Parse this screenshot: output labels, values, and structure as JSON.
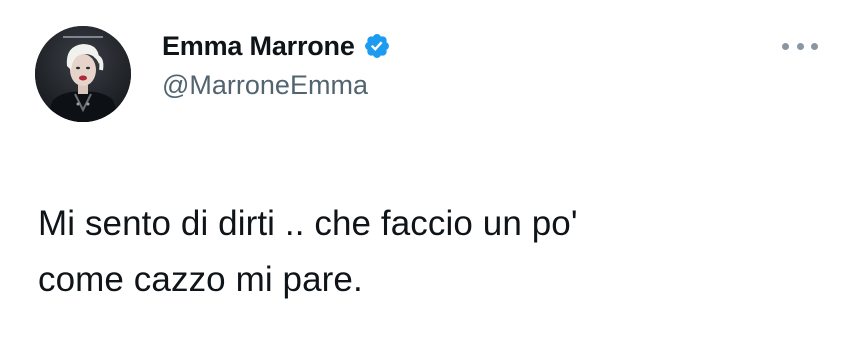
{
  "tweet": {
    "author": {
      "display_name": "Emma Marrone",
      "handle": "@MarroneEmma",
      "verified": true,
      "avatar_icon": "profile-photo"
    },
    "more_menu_icon": "ellipsis-icon",
    "text_lines": [
      "Mi sento di dirti .. che faccio un po'",
      "come cazzo mi pare."
    ]
  },
  "colors": {
    "verified_badge": "#1d9bf0",
    "handle_text": "#536471",
    "primary_text": "#0f1419"
  }
}
